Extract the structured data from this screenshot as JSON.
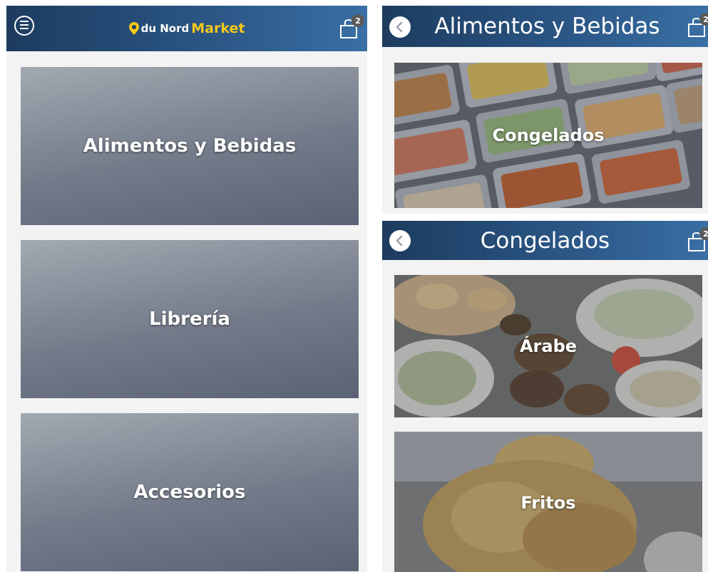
{
  "colors": {
    "header_start": "#1d3c5f",
    "header_end": "#3a6fa5",
    "logo_accent": "#f6c817",
    "tile_gradient_light": "#a2a9b1",
    "tile_gradient_dark": "#5b6275",
    "badge": "#5a5a5a"
  },
  "screen_home": {
    "header": {
      "menu_icon": "hamburger-circle-icon",
      "logo": {
        "pin_icon": "location-pin-icon",
        "brand_part1": "du Nord",
        "brand_part2": "Market"
      },
      "cart": {
        "icon": "shopping-bag-icon",
        "badge": "2"
      }
    },
    "categories": [
      {
        "label": "Alimentos y Bebidas"
      },
      {
        "label": "Librería"
      },
      {
        "label": "Accesorios"
      }
    ]
  },
  "screen_food": {
    "header": {
      "back_icon": "back-arrow-icon",
      "title": "Alimentos y Bebidas",
      "cart": {
        "icon": "shopping-bag-icon",
        "badge": "2"
      }
    },
    "subcategories": [
      {
        "label": "Congelados"
      }
    ]
  },
  "screen_frozen": {
    "header": {
      "back_icon": "back-arrow-icon",
      "title": "Congelados",
      "cart": {
        "icon": "shopping-bag-icon",
        "badge": "2"
      }
    },
    "subcategories": [
      {
        "label": "Árabe"
      },
      {
        "label": "Fritos"
      }
    ]
  }
}
